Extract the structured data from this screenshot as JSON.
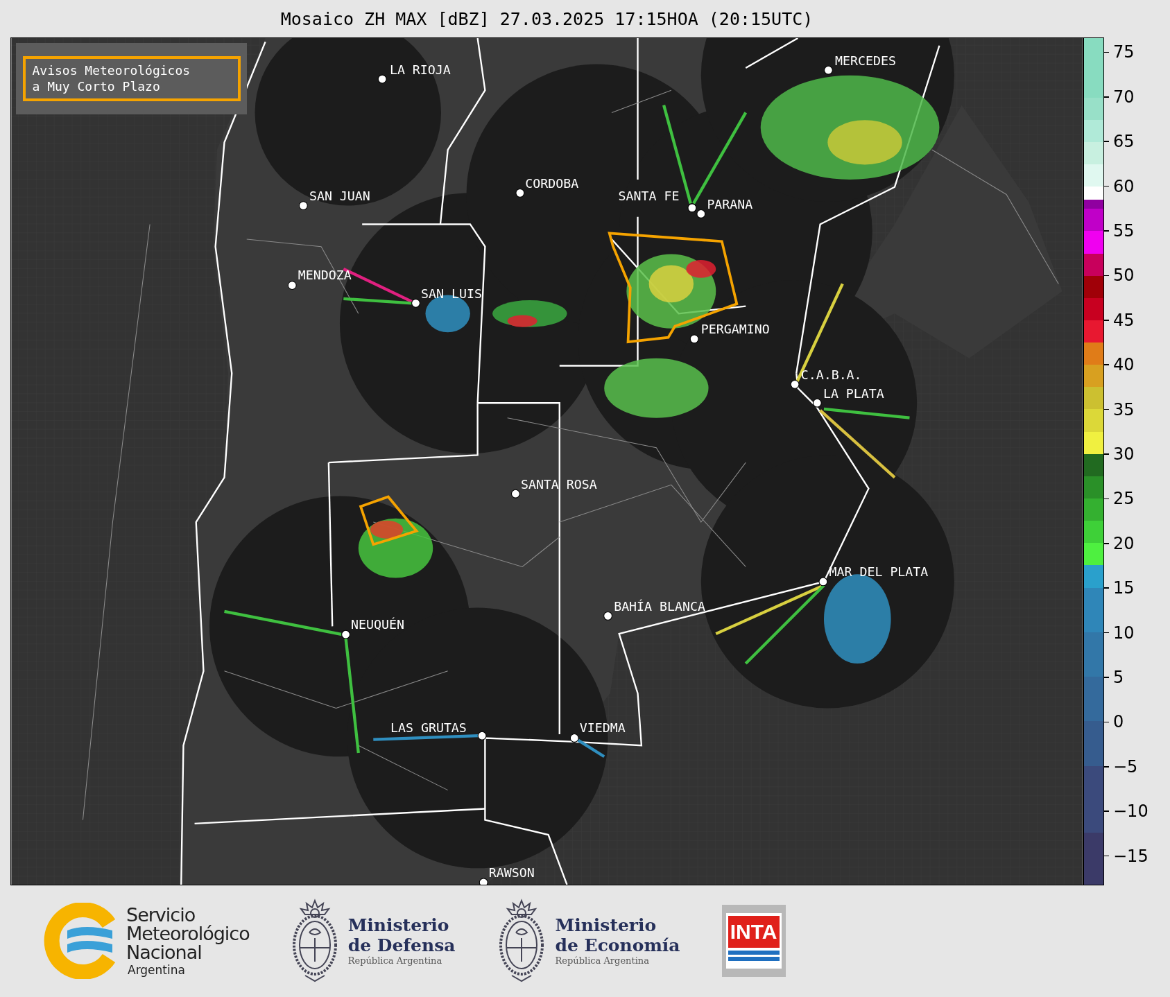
{
  "title": "Mosaico ZH MAX [dBZ] 27.03.2025 17:15HOA (20:15UTC)",
  "legend": {
    "text": "Avisos Meteorológicos\na Muy Corto Plazo"
  },
  "cities": [
    {
      "name": "LA RIOJA"
    },
    {
      "name": "SAN JUAN"
    },
    {
      "name": "CORDOBA"
    },
    {
      "name": "SANTA FE"
    },
    {
      "name": "PARANA"
    },
    {
      "name": "MENDOZA"
    },
    {
      "name": "SAN LUIS"
    },
    {
      "name": "PERGAMINO"
    },
    {
      "name": "MERCEDES"
    },
    {
      "name": "C.A.B.A."
    },
    {
      "name": "LA PLATA"
    },
    {
      "name": "SANTA ROSA"
    },
    {
      "name": "MAR DEL PLATA"
    },
    {
      "name": "BAHÍA BLANCA"
    },
    {
      "name": "NEUQUÉN"
    },
    {
      "name": "LAS GRUTAS"
    },
    {
      "name": "VIEDMA"
    },
    {
      "name": "RAWSON"
    }
  ],
  "colorbar": {
    "ticks": [
      "75",
      "70",
      "65",
      "60",
      "55",
      "50",
      "45",
      "40",
      "35",
      "30",
      "25",
      "20",
      "15",
      "10",
      "5",
      "0",
      "−5",
      "−10",
      "−15"
    ]
  },
  "footer": {
    "smn": {
      "lines": [
        "Servicio",
        "Meteorológico",
        "Nacional"
      ],
      "country": "Argentina"
    },
    "ministries": [
      {
        "name": "Ministerio",
        "department": "de Defensa",
        "country": "República Argentina"
      },
      {
        "name": "Ministerio",
        "department": "de Economía",
        "country": "República Argentina"
      }
    ],
    "inta": {
      "text": "INTA"
    }
  }
}
